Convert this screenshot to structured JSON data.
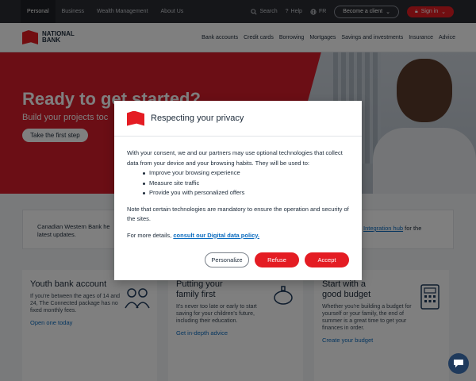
{
  "topbar": {
    "tabs": [
      "Personal",
      "Business",
      "Wealth Management",
      "About Us"
    ],
    "search_label": "Search",
    "help_label": "Help",
    "lang_label": "FR",
    "become_client_label": "Become a client",
    "signin_label": "Sign in"
  },
  "nav": {
    "logo_text": "NATIONAL BANK",
    "links": [
      "Bank accounts",
      "Credit cards",
      "Borrowing",
      "Mortgages",
      "Savings and investments",
      "Insurance",
      "Advice"
    ]
  },
  "hero": {
    "title": "Ready to get started?",
    "subtitle": "Build your projects toc",
    "button_label": "Take the first step"
  },
  "notice": {
    "text_left": "Canadian Western Bank he",
    "text_left_2": "latest updates.",
    "link_text": "Integration hub",
    "text_right": " for the"
  },
  "cards": [
    {
      "title": "Youth bank account",
      "text": "If you're between the ages of 14 and 24, The Connected package has no fixed monthly fees.",
      "link": "Open one today"
    },
    {
      "title": "Putting your family first",
      "text": "It's never too late or early to start saving for your children's future, including their education.",
      "link": "Get in-depth advice"
    },
    {
      "title": "Start with a good budget",
      "text": "Whether you're building a budget for yourself or your family, the end of summer is a great time to get your finances in order.",
      "link": "Create your budget"
    }
  ],
  "modal": {
    "title": "Respecting your privacy",
    "intro": "With your consent, we and our partners may use optional technologies that collect data from your device and your browsing habits. They will be used to:",
    "bullets": [
      "Improve your browsing experience",
      "Measure site traffic",
      "Provide you with personalized offers"
    ],
    "note": "Note that certain technologies are mandatory to ensure the operation and security of the sites.",
    "details_prefix": "For more details, ",
    "details_link": "consult our Digital data policy.",
    "buttons": {
      "personalize": "Personalize",
      "refuse": "Refuse",
      "accept": "Accept"
    }
  },
  "colors": {
    "brand_red": "#e41c23",
    "link_blue": "#0a6bbf",
    "topbar_bg": "#2b2d33"
  }
}
